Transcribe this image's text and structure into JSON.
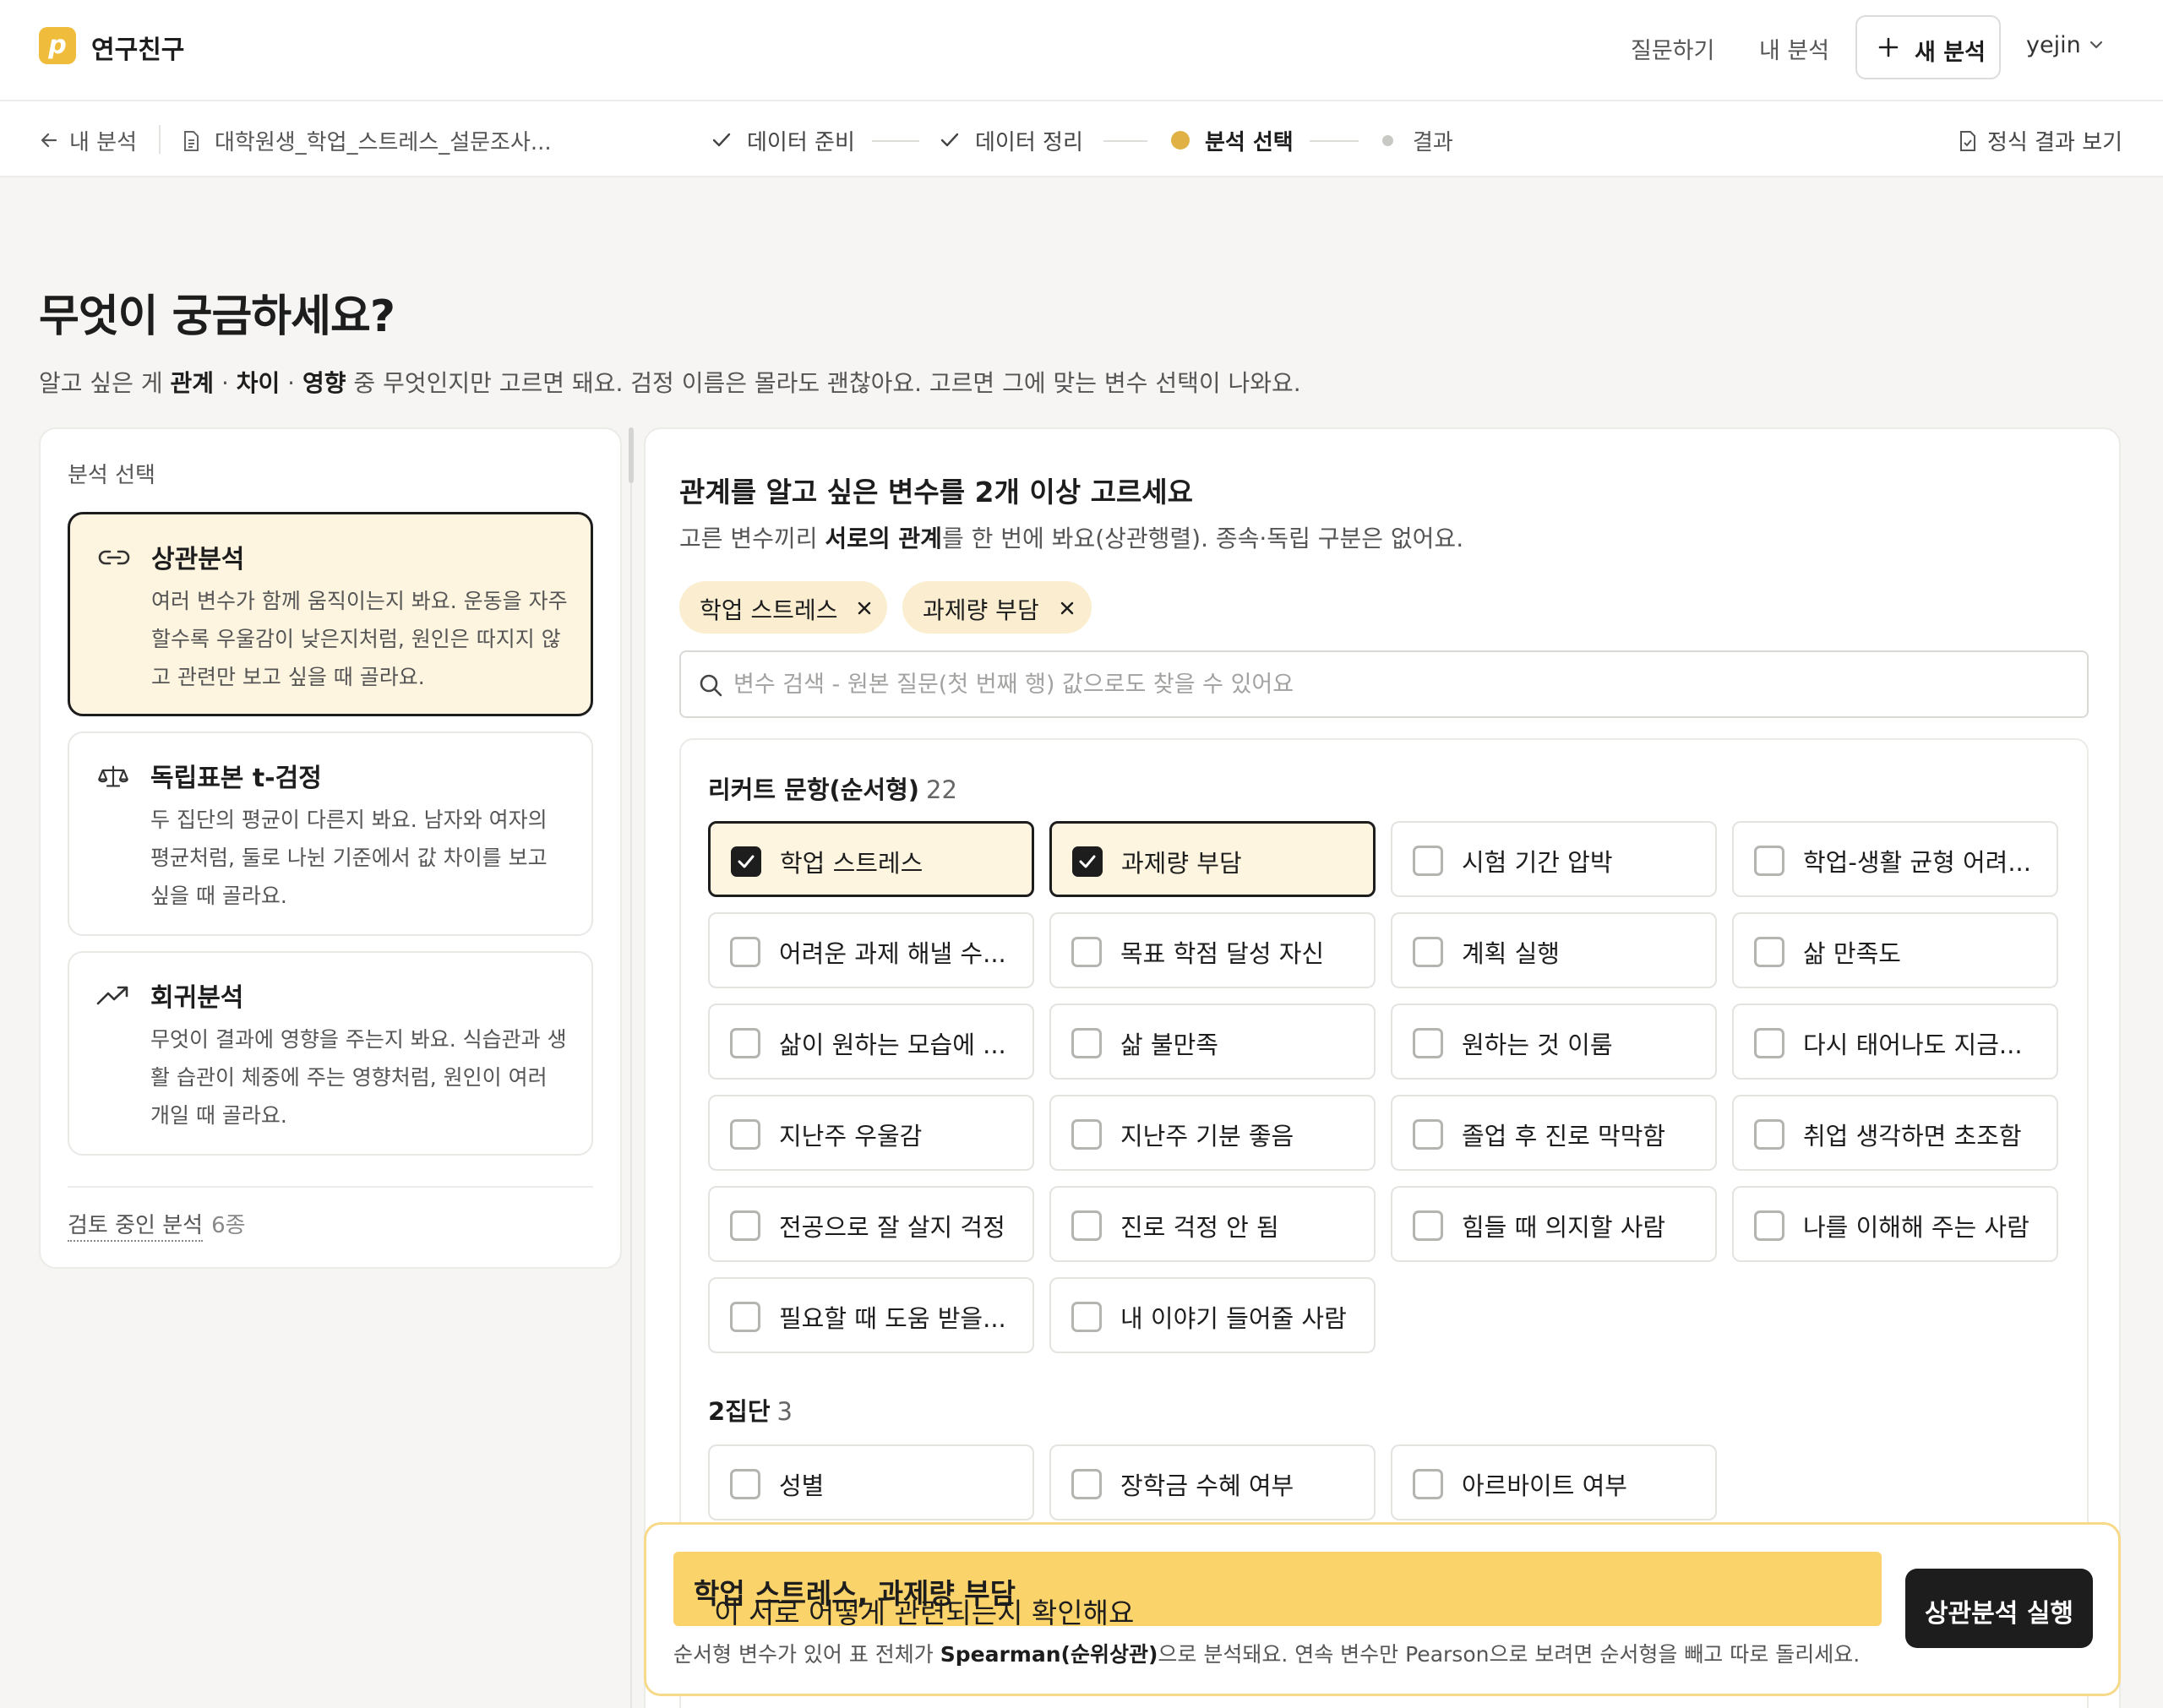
{
  "header": {
    "brand": "연구친구",
    "nav": [
      "질문하기",
      "내 분석"
    ],
    "new_analysis": "새 분석",
    "user": "yejin"
  },
  "stepbar": {
    "back": "내 분석",
    "file": "대학원생_학업_스트레스_설문조사...",
    "steps": [
      {
        "label": "데이터 준비",
        "state": "done"
      },
      {
        "label": "데이터 정리",
        "state": "done"
      },
      {
        "label": "분석 선택",
        "state": "active"
      },
      {
        "label": "결과",
        "state": "pending"
      }
    ],
    "report": "정식 결과 보기"
  },
  "page": {
    "title": "무엇이 궁금하세요?",
    "subtitle": {
      "prefix": "알고 싶은 게 ",
      "k1": "관계",
      "sep1": " · ",
      "k2": "차이",
      "sep2": " · ",
      "k3": "영향",
      "suffix": " 중 무엇인지만 고르면 돼요. 검정 이름은 몰라도 괜찮아요. 고르면 그에 맞는 변수 선택이 나와요."
    }
  },
  "analysis_panel": {
    "title": "분석 선택",
    "items": [
      {
        "name": "상관분석",
        "icon": "link-icon",
        "selected": true,
        "desc": "여러 변수가 함께 움직이는지 봐요. 운동을 자주 할수록 우울감이 낮은지처럼, 원인은 따지지 않고 관련만 보고 싶을 때 골라요."
      },
      {
        "name": "독립표본 t-검정",
        "icon": "scale-icon",
        "selected": false,
        "desc": "두 집단의 평균이 다른지 봐요. 남자와 여자의 평균처럼, 둘로 나뉜 기준에서 값 차이를 보고 싶을 때 골라요."
      },
      {
        "name": "회귀분석",
        "icon": "trend-up-icon",
        "selected": false,
        "desc": "무엇이 결과에 영향을 주는지 봐요. 식습관과 생활 습관이 체중에 주는 영향처럼, 원인이 여러 개일 때 골라요."
      }
    ],
    "review_label": "검토 중인 분석",
    "review_count": "6종"
  },
  "variable_panel": {
    "title": "관계를 알고 싶은 변수를 2개 이상 고르세요",
    "subtitle": {
      "prefix": "고른 변수끼리 ",
      "bold": "서로의 관계",
      "suffix": "를 한 번에 봐요(상관행렬). 종속·독립 구분은 없어요."
    },
    "chips": [
      "학업 스트레스",
      "과제량 부담"
    ],
    "search_placeholder": "변수 검색 - 원본 질문(첫 번째 행) 값으로도 찾을 수 있어요",
    "groups": [
      {
        "name": "리커트 문항(순서형)",
        "count": "22",
        "items": [
          {
            "label": "학업 스트레스",
            "checked": true
          },
          {
            "label": "과제량 부담",
            "checked": true
          },
          {
            "label": "시험 기간 압박",
            "checked": false
          },
          {
            "label": "학업-생활 균형 어려...",
            "checked": false
          },
          {
            "label": "어려운 과제 해낼 수...",
            "checked": false
          },
          {
            "label": "목표 학점 달성 자신",
            "checked": false
          },
          {
            "label": "계획 실행",
            "checked": false
          },
          {
            "label": "삶 만족도",
            "checked": false
          },
          {
            "label": "삶이 원하는 모습에 ...",
            "checked": false
          },
          {
            "label": "삶 불만족",
            "checked": false
          },
          {
            "label": "원하는 것 이룸",
            "checked": false
          },
          {
            "label": "다시 태어나도 지금...",
            "checked": false
          },
          {
            "label": "지난주 우울감",
            "checked": false
          },
          {
            "label": "지난주 기분 좋음",
            "checked": false
          },
          {
            "label": "졸업 후 진로 막막함",
            "checked": false
          },
          {
            "label": "취업 생각하면 초조함",
            "checked": false
          },
          {
            "label": "전공으로 잘 살지 걱정",
            "checked": false
          },
          {
            "label": "진로 걱정 안 됨",
            "checked": false
          },
          {
            "label": "힘들 때 의지할 사람",
            "checked": false
          },
          {
            "label": "나를 이해해 주는 사람",
            "checked": false
          },
          {
            "label": "필요할 때 도움 받을...",
            "checked": false
          },
          {
            "label": "내 이야기 들어줄 사람",
            "checked": false
          }
        ]
      },
      {
        "name": "2집단",
        "count": "3",
        "items": [
          {
            "label": "성별",
            "checked": false
          },
          {
            "label": "장학금 수혜 여부",
            "checked": false
          },
          {
            "label": "아르바이트 여부",
            "checked": false
          }
        ]
      }
    ]
  },
  "action": {
    "headline_vars": "학업 스트레스, 과제량 부담",
    "headline_suffix": "이 서로 어떻게 관련되는지 확인해요",
    "note_prefix": "순서형 변수가 있어 표 전체가 ",
    "note_bold": "Spearman(순위상관)",
    "note_suffix": "으로 분석돼요. 연속 변수만 Pearson으로 보려면 순서형을 빼고 따로 돌리세요.",
    "run": "상관분석 실행"
  },
  "colors": {
    "accent": "#f0bc3c",
    "selected_bg": "#fdf5e0",
    "highlight": "#fbd36b",
    "dark": "#1d1d1d"
  }
}
